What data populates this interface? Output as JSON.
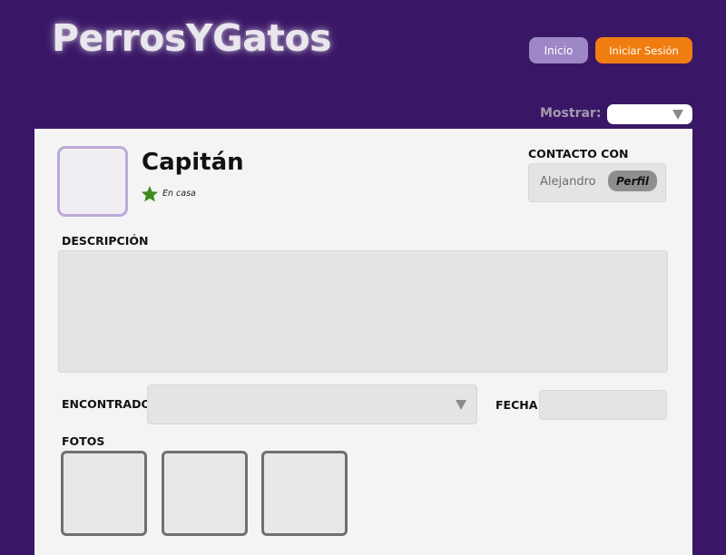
{
  "header": {
    "logo_text": "PerrosYGatos",
    "nav": {
      "inicio_label": "Inicio",
      "login_label": "Iniciar Sesión"
    },
    "filter": {
      "label": "Mostrar:",
      "selected_value": ""
    }
  },
  "pet": {
    "name": "Capitán",
    "status_icon": "star-icon",
    "status_text": "En casa"
  },
  "contact": {
    "title": "CONTACTO CON",
    "name": "Alejandro",
    "profile_button_label": "Perfil"
  },
  "description": {
    "label": "DESCRIPCIÓN",
    "value": ""
  },
  "found": {
    "label": "ENCONTRADO",
    "selected_value": ""
  },
  "date": {
    "label": "FECHA",
    "value": ""
  },
  "photos": {
    "label": "FOTOS",
    "count": 3
  },
  "colors": {
    "background": "#3a1766",
    "inicio_button": "#9e87c7",
    "login_button": "#f07d10",
    "avatar_border": "#bcaad8",
    "status_star": "#3f8a1e",
    "card": "#f4f4f4"
  }
}
